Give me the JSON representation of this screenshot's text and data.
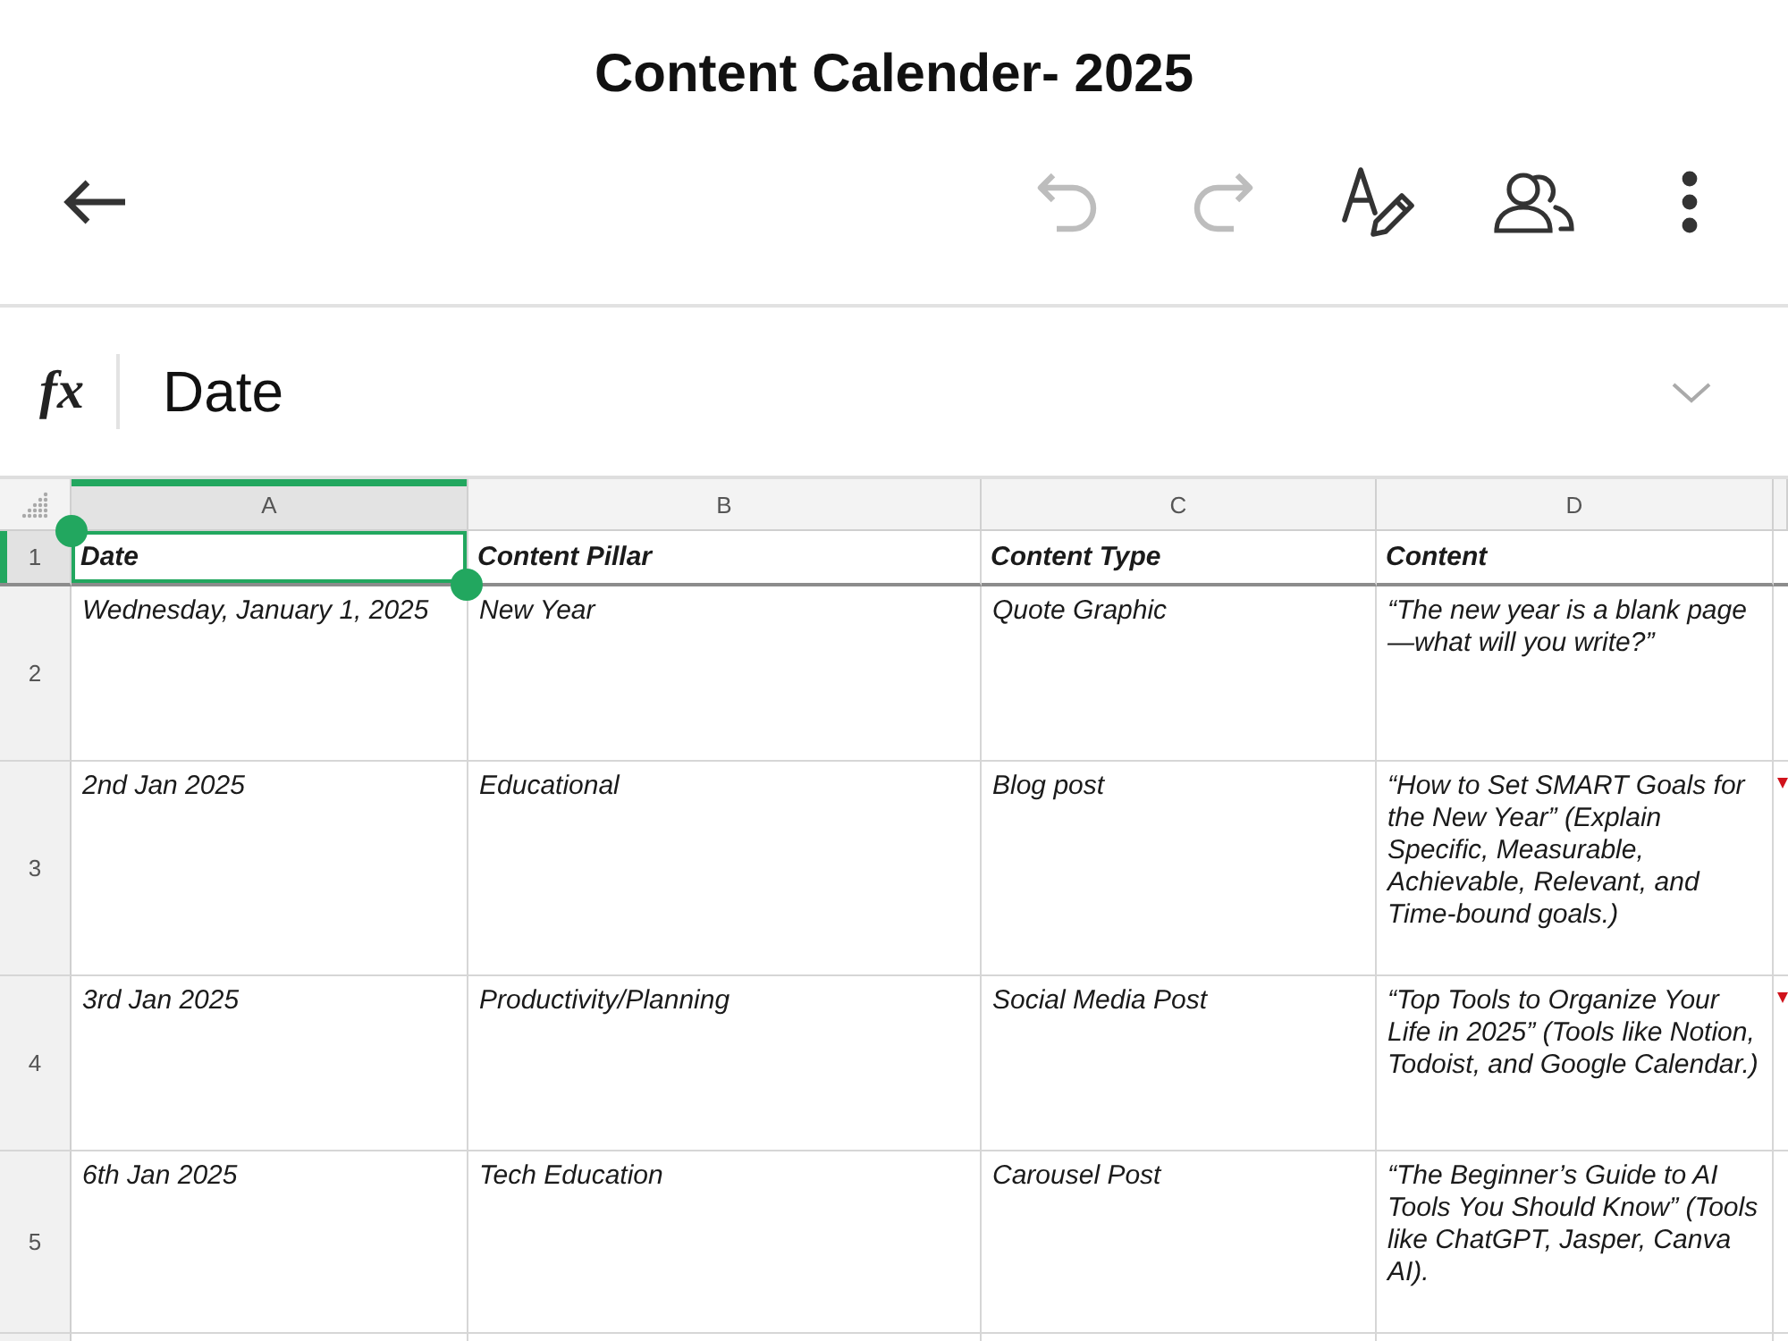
{
  "title": "Content Calender- 2025",
  "toolbar": [
    {
      "kind": "back",
      "disabled": false
    },
    {
      "kind": "undo",
      "disabled": true
    },
    {
      "kind": "redo",
      "disabled": true
    },
    {
      "kind": "format",
      "disabled": false
    },
    {
      "kind": "collaborators",
      "disabled": false
    },
    {
      "kind": "more",
      "disabled": false
    }
  ],
  "formula_bar": {
    "label": "fx",
    "value": "Date"
  },
  "grid": {
    "columns": [
      {
        "label": "A",
        "selected": true
      },
      {
        "label": "B",
        "selected": false
      },
      {
        "label": "C",
        "selected": false
      },
      {
        "label": "D",
        "selected": false
      }
    ],
    "rows": [
      {
        "number": "1",
        "kind": "header",
        "selected": true,
        "note": false,
        "cells": [
          "Date",
          "Content Pillar",
          "Content Type",
          "Content"
        ]
      },
      {
        "number": "2",
        "kind": "data",
        "selected": false,
        "note": false,
        "cells": [
          "Wednesday, January 1, 2025",
          "New Year",
          "Quote Graphic",
          "“The new year is a blank page—what will you write?”"
        ]
      },
      {
        "number": "3",
        "kind": "data",
        "selected": false,
        "note": true,
        "cells": [
          "2nd Jan 2025",
          "Educational",
          "Blog post",
          "“How to Set SMART Goals for the New Year” (Explain Specific, Measurable, Achievable, Relevant, and Time-bound goals.)"
        ]
      },
      {
        "number": "4",
        "kind": "data",
        "selected": false,
        "note": true,
        "cells": [
          "3rd Jan 2025",
          "Productivity/Planning",
          "Social Media Post",
          "“Top Tools to Organize Your Life in 2025” (Tools like Notion, Todoist, and Google Calendar.)"
        ]
      },
      {
        "number": "5",
        "kind": "data",
        "selected": false,
        "note": false,
        "cells": [
          "6th Jan 2025",
          "Tech Education",
          "Carousel Post",
          "“The Beginner’s Guide to AI Tools You Should Know” (Tools like ChatGPT, Jasper, Canva AI)."
        ]
      }
    ]
  }
}
